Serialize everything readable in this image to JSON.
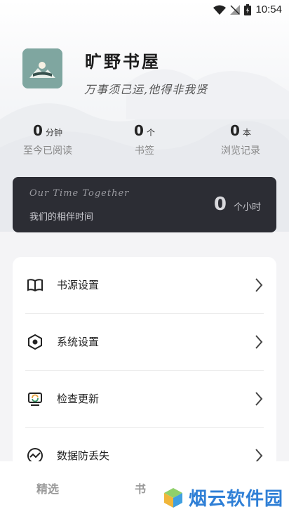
{
  "status_bar": {
    "time": "10:54"
  },
  "header": {
    "app_name": "旷野书屋",
    "slogan": "万事须己运,他得非我贤"
  },
  "stats": [
    {
      "value": "0",
      "unit": "分钟",
      "label": "至今已阅读"
    },
    {
      "value": "0",
      "unit": "个",
      "label": "书签"
    },
    {
      "value": "0",
      "unit": "本",
      "label": "浏览记录"
    }
  ],
  "banner": {
    "title_en": "Our Time Together",
    "title_cn": "我们的相伴时间",
    "hours_value": "0",
    "hours_unit": "个小时"
  },
  "menu": [
    {
      "label": "书源设置",
      "icon": "book-icon"
    },
    {
      "label": "系统设置",
      "icon": "settings-hex-icon"
    },
    {
      "label": "检查更新",
      "icon": "update-icon"
    },
    {
      "label": "数据防丢失",
      "icon": "chart-line-icon"
    }
  ],
  "bottom_nav": {
    "tab_1": "精选",
    "tab_2_partial": "书"
  },
  "watermark": {
    "text": "烟云软件园"
  },
  "colors": {
    "banner_bg": "#2c2d34",
    "logo_bg": "#7fa6a0",
    "watermark": "#2f7fd6"
  }
}
